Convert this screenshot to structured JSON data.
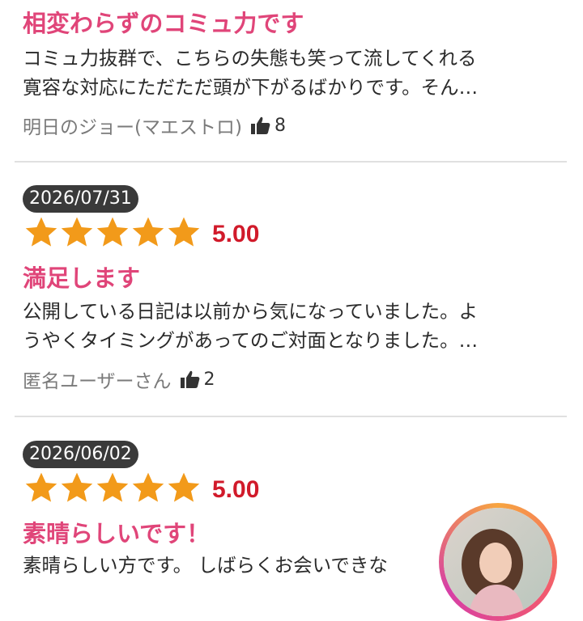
{
  "reviews": [
    {
      "title": "相変わらずのコミュ力です",
      "body": [
        "コミュ力抜群で、こちらの失態も笑って流してくれる",
        "寛容な対応にただただ頭が下がるばかりです。そん…"
      ],
      "author": "明日のジョー(マエストロ)",
      "likes": "8"
    },
    {
      "date": "2026/07/31",
      "rating": 5,
      "score": "5.00",
      "title": "満足します",
      "body": [
        "公開している日記は以前から気になっていました。よ",
        "うやくタイミングがあってのご対面となりました。…"
      ],
      "author": "匿名ユーザーさん",
      "likes": "2"
    },
    {
      "date": "2026/06/02",
      "rating": 5,
      "score": "5.00",
      "title": "素晴らしいです！",
      "body": [
        "素晴らしい方です。 しばらくお会いできな"
      ]
    }
  ],
  "colors": {
    "title": "#e04579",
    "score": "#d11a2a",
    "star": "#f29a1a",
    "date_bg": "#3a3a3a"
  },
  "icons": {
    "like": "thumbs-up-icon",
    "star": "star-icon",
    "avatar": "profile-avatar"
  }
}
